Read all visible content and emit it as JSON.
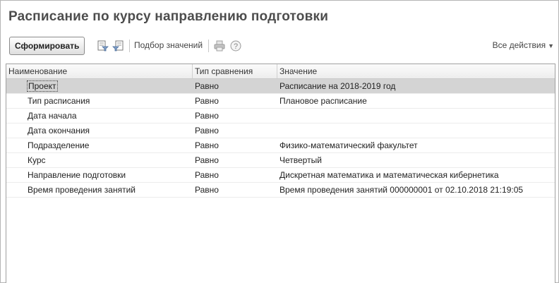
{
  "window": {
    "title": "Расписание по курсу направлению подготовки"
  },
  "toolbar": {
    "generate_label": "Сформировать",
    "pick_values_label": "Подбор значений",
    "all_actions_label": "Все действия",
    "icons": [
      "filter-icon",
      "filter-clear-icon",
      "print-icon",
      "help-icon"
    ]
  },
  "grid": {
    "columns": [
      "Наименование",
      "Тип сравнения",
      "Значение"
    ],
    "rows": [
      {
        "name": "Проект",
        "compare": "Равно",
        "value": "Расписание на 2018-2019 год",
        "selected": true
      },
      {
        "name": "Тип расписания",
        "compare": "Равно",
        "value": "Плановое расписание"
      },
      {
        "name": "Дата начала",
        "compare": "Равно",
        "value": ""
      },
      {
        "name": "Дата окончания",
        "compare": "Равно",
        "value": ""
      },
      {
        "name": "Подразделение",
        "compare": "Равно",
        "value": "Физико-математический факультет"
      },
      {
        "name": "Курс",
        "compare": "Равно",
        "value": "Четвертый"
      },
      {
        "name": "Направление подготовки",
        "compare": "Равно",
        "value": "Дискретная математика и математическая кибернетика"
      },
      {
        "name": "Время проведения занятий",
        "compare": "Равно",
        "value": "Время проведения занятий 000000001 от 02.10.2018 21:19:05"
      }
    ]
  }
}
